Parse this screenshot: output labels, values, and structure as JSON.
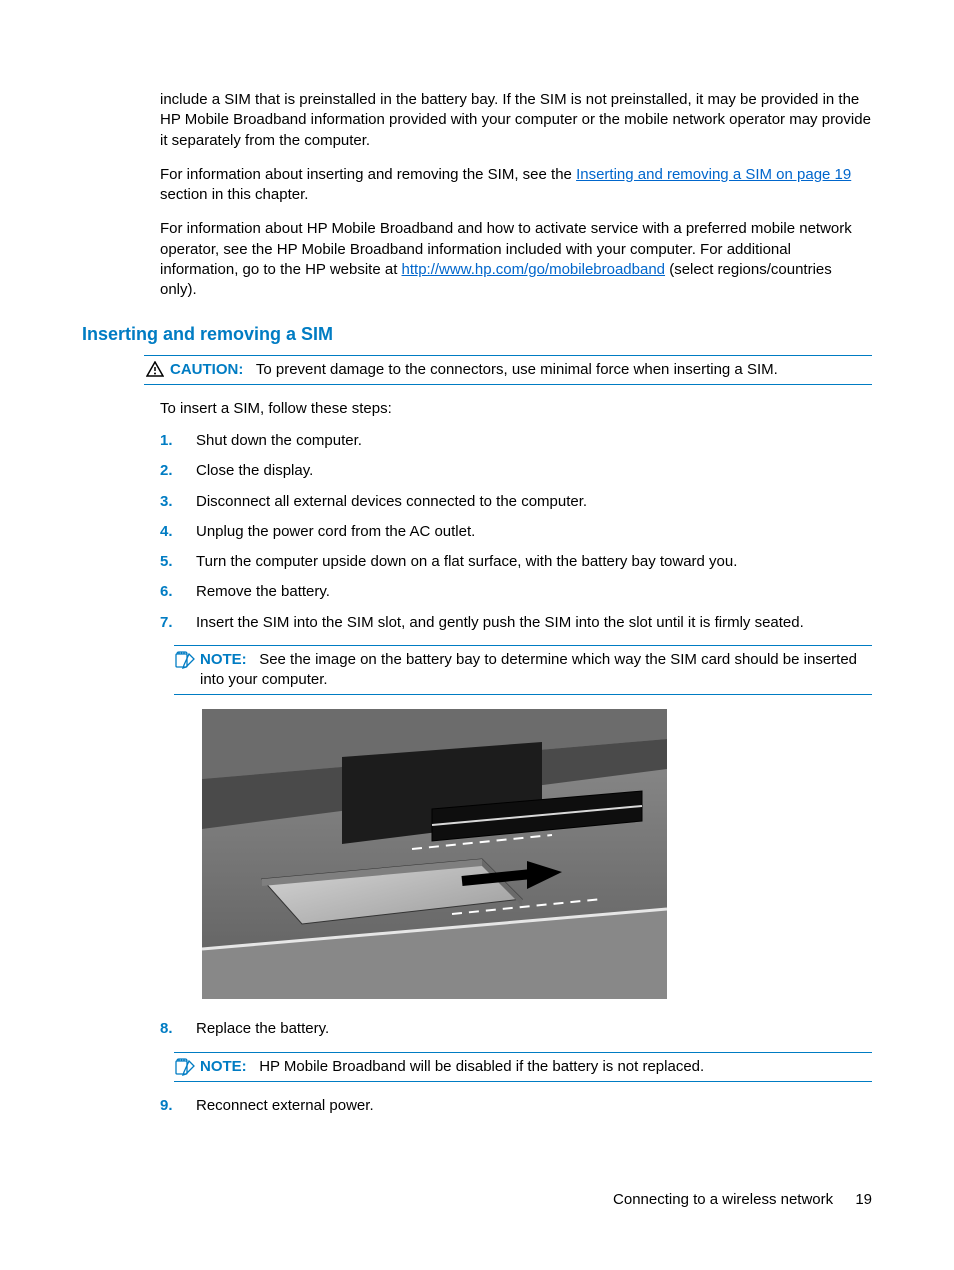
{
  "intro": {
    "p1": "include a SIM that is preinstalled in the battery bay. If the SIM is not preinstalled, it may be provided in the HP Mobile Broadband information provided with your computer or the mobile network operator may provide it separately from the computer.",
    "p2_before": "For information about inserting and removing the SIM, see the ",
    "p2_link": "Inserting and removing a SIM on page 19",
    "p2_after": " section in this chapter.",
    "p3_before": "For information about HP Mobile Broadband and how to activate service with a preferred mobile network operator, see the HP Mobile Broadband information included with your computer. For additional information, go to the HP website at ",
    "p3_link": "http://www.hp.com/go/mobilebroadband",
    "p3_after": " (select regions/countries only)."
  },
  "section_heading": "Inserting and removing a SIM",
  "caution": {
    "label": "CAUTION:",
    "text": "To prevent damage to the connectors, use minimal force when inserting a SIM."
  },
  "steps_intro": "To insert a SIM, follow these steps:",
  "steps_a": [
    "Shut down the computer.",
    "Close the display.",
    "Disconnect all external devices connected to the computer.",
    "Unplug the power cord from the AC outlet.",
    "Turn the computer upside down on a flat surface, with the battery bay toward you.",
    "Remove the battery.",
    "Insert the SIM into the SIM slot, and gently push the SIM into the slot until it is firmly seated."
  ],
  "note1": {
    "label": "NOTE:",
    "text": "See the image on the battery bay to determine which way the SIM card should be inserted into your computer."
  },
  "steps_b": [
    "Replace the battery."
  ],
  "note2": {
    "label": "NOTE:",
    "text": "HP Mobile Broadband will be disabled if the battery is not replaced."
  },
  "steps_c": [
    "Reconnect external power."
  ],
  "footer": {
    "title": "Connecting to a wireless network",
    "page": "19"
  },
  "icons": {
    "caution": "caution-triangle-icon",
    "note": "note-pencil-icon"
  }
}
